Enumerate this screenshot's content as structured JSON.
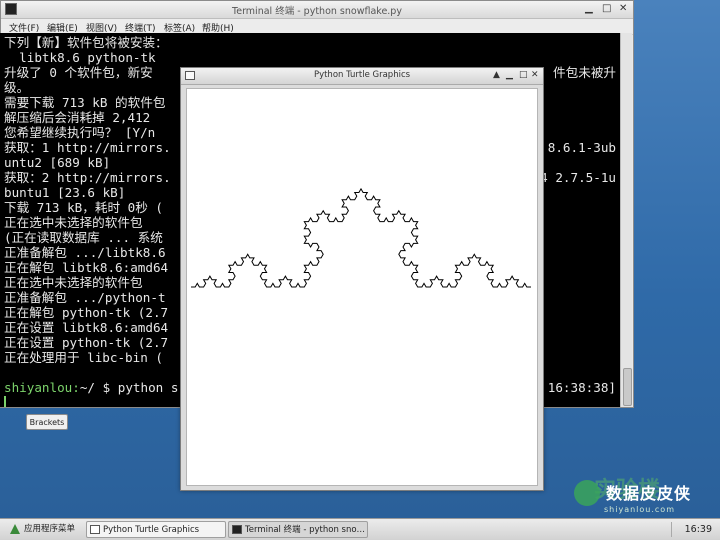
{
  "terminal": {
    "title": "Terminal 终端 - python snowflake.py",
    "menu": [
      "文件(F)",
      "编辑(E)",
      "视图(V)",
      "终端(T)",
      "标签(A)",
      "帮助(H)"
    ],
    "lines": [
      "下列【新】软件包将被安装：",
      "  libtk8.6 python-tk",
      "升级了 0 个软件包，新安",
      "级。",
      "需要下载 713 kB 的软件包",
      "解压缩后会消耗掉 2,412 ",
      "您希望继续执行吗？ [Y/n",
      "获取：1 http://mirrors.",
      "untu2 [689 kB]",
      "获取：2 http://mirrors.",
      "buntu1 [23.6 kB]",
      "下载 713 kB，耗时 0秒 (",
      "正在选中未选择的软件包 ",
      "(正在读取数据库 ... 系统",
      "正准备解包 .../libtk8.6",
      "正在解包 libtk8.6:amd64",
      "正在选中未选择的软件包 ",
      "正准备解包 .../python-t",
      "正在解包 python-tk (2.7",
      "正在设置 libtk8.6:amd64",
      "正在设置 python-tk (2.7",
      "正在处理用于 libc-bin ("
    ],
    "right_fragments": [
      {
        "line": 2,
        "text": "件包未被升"
      },
      {
        "line": 7,
        "text": "8.6.1-3ub"
      },
      {
        "line": 9,
        "text": "4 2.7.5-1u"
      },
      {
        "line": 23,
        "text": "16:38:38]"
      }
    ],
    "prompt_user": "shiyanlou:",
    "prompt_rest": "~/ $ python s",
    "prompt_line": 23
  },
  "turtle": {
    "title": "Python Turtle Graphics",
    "curve_order": 4
  },
  "desktop": {
    "button_label": "Brackets"
  },
  "watermark": {
    "text": "数据皮皮侠",
    "sub": "shiyanlou.com",
    "bg_text": "实验楼"
  },
  "taskbar": {
    "app_menu": "应用程序菜单",
    "tasks": [
      "Python Turtle Graphics",
      "Terminal 终端 - python sno…"
    ],
    "clock": "16:39"
  }
}
